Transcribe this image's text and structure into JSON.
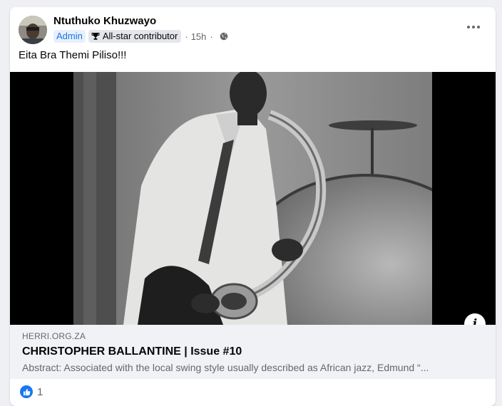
{
  "post": {
    "author": "Ntuthuko Khuzwayo",
    "badges": {
      "admin": "Admin",
      "contributor": "All-star contributor"
    },
    "separator": "·",
    "time": "15h",
    "privacy_icon": "globe-icon",
    "text": "Eita Bra Themi Piliso!!!"
  },
  "link_preview": {
    "domain": "HERRI.ORG.ZA",
    "title": "CHRISTOPHER BALLANTINE | Issue #10",
    "description": "Abstract: Associated with the local swing style usually described as African jazz, Edmund “..."
  },
  "reactions": {
    "icon": "like-icon",
    "count": "1"
  },
  "colors": {
    "accent": "#1877f2",
    "admin_badge_bg": "#e7f0fd",
    "admin_badge_text": "#1b74e4",
    "link_bg": "#f0f2f5"
  }
}
